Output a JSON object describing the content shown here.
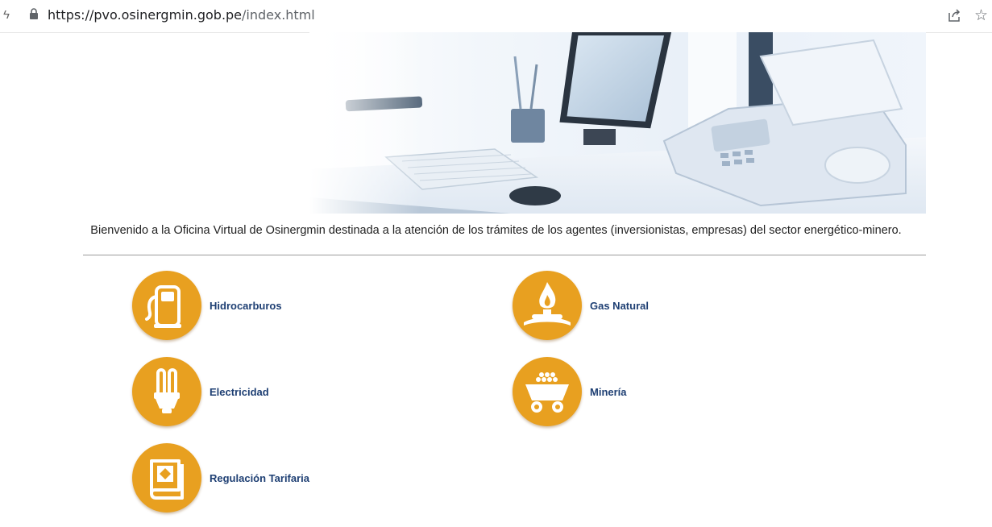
{
  "browser": {
    "url_host": "https://pvo.osinergmin.gob.pe",
    "url_path": "/index.html",
    "left_stub": "ϟ"
  },
  "welcome_text": "Bienvenido a la Oficina Virtual de Osinergmin destinada a la atención de los trámites de los agentes (inversionistas, empresas) del sector energético-minero.",
  "sectors": [
    {
      "label": "Hidrocarburos",
      "icon": "fuel-pump-icon"
    },
    {
      "label": "Gas Natural",
      "icon": "gas-flame-icon"
    },
    {
      "label": "Electricidad",
      "icon": "light-bulb-icon"
    },
    {
      "label": "Minería",
      "icon": "mine-cart-icon"
    },
    {
      "label": "Regulación Tarifaria",
      "icon": "regulation-book-icon"
    }
  ],
  "colors": {
    "icon_circle": "#e8a020",
    "link_text": "#1e3f73"
  }
}
